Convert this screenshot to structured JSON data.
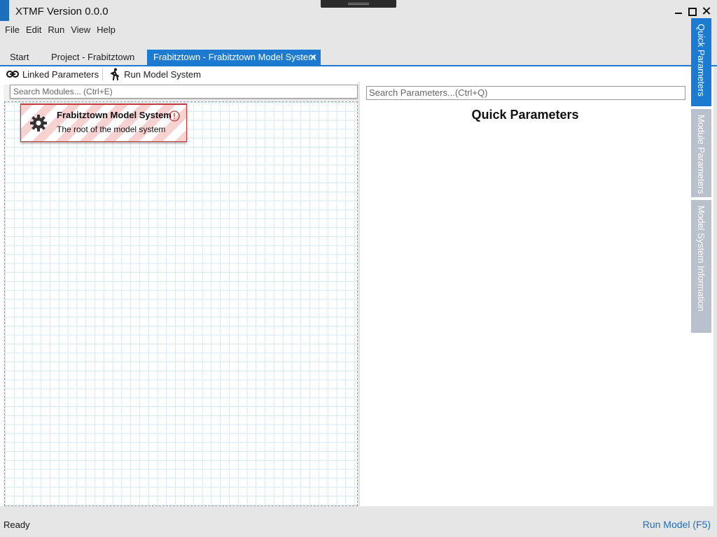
{
  "window": {
    "title": "XTMF Version 0.0.0"
  },
  "menu": {
    "items": [
      "File",
      "Edit",
      "Run",
      "View",
      "Help"
    ]
  },
  "tabs": {
    "start": "Start",
    "project": "Project - Frabitztown",
    "active": "Frabitztown - Frabitztown Model System",
    "close_glyph": "✕"
  },
  "toolbar": {
    "linked_parameters": "Linked Parameters",
    "run_model_system": "Run Model System"
  },
  "module_search": {
    "placeholder": "Search Modules... (Ctrl+E)"
  },
  "module": {
    "title": "Frabitztown Model System",
    "description": "The root of the model system",
    "icon": "gear-icon",
    "status_icon": "warning-icon"
  },
  "parameters": {
    "placeholder": "Search Parameters...(Ctrl+Q)",
    "heading": "Quick Parameters"
  },
  "side_tabs": [
    "Quick Parameters",
    "Module Parameters",
    "Model System Information"
  ],
  "status": {
    "text": "Ready",
    "run_model": "Run Model (F5)"
  },
  "colors": {
    "accent": "#1c7bd0",
    "warning": "#c03a3a"
  }
}
